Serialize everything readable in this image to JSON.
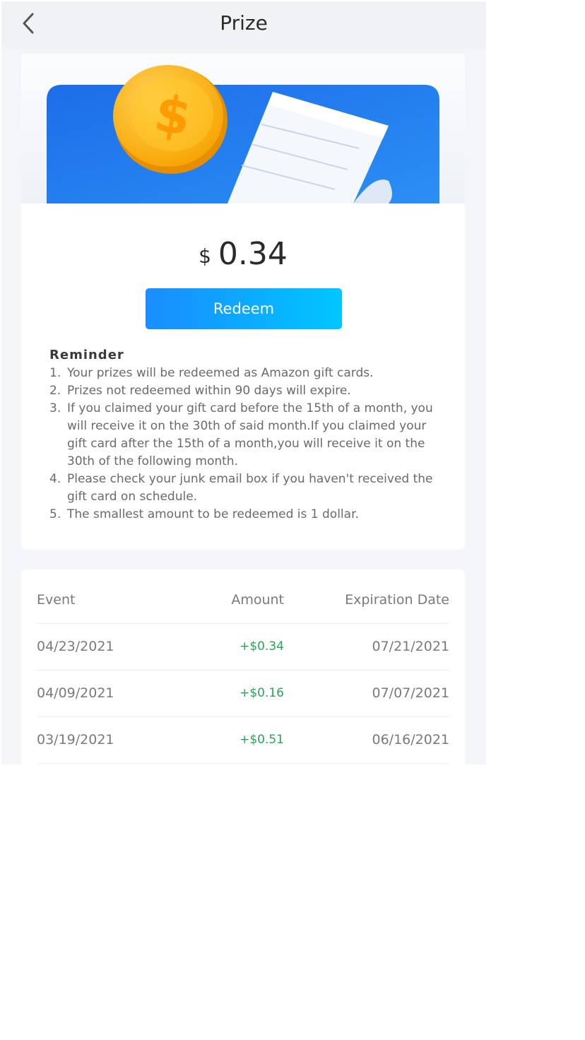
{
  "header": {
    "title": "Prize",
    "back_icon": "chevron-left-icon"
  },
  "banner": {
    "icons": [
      "dollar-coin-icon",
      "receipt-icon"
    ],
    "colors": {
      "blue": "#1f7cf0",
      "coin": "#ffb81a"
    }
  },
  "prize": {
    "currency": "$",
    "amount": "0.34",
    "redeem_label": "Redeem"
  },
  "reminder": {
    "title": "Reminder",
    "items": [
      {
        "num": "1.",
        "text": "Your prizes will be redeemed as Amazon gift cards."
      },
      {
        "num": "2.",
        "text": "Prizes not redeemed within 90 days will expire."
      },
      {
        "num": "3.",
        "text": "If you claimed your gift card before the 15th of a month, you will receive it on the 30th of said month.If you claimed your gift card after the 15th of a month,you will receive it on the 30th of the following month."
      },
      {
        "num": "4.",
        "text": "Please check your junk email box if you haven't received the gift card on schedule."
      },
      {
        "num": "5.",
        "text": "The smallest amount to be redeemed is 1 dollar."
      }
    ]
  },
  "events": {
    "columns": [
      "Event",
      "Amount",
      "Expiration Date"
    ],
    "rows": [
      {
        "event": "04/23/2021",
        "amount": "+$0.34",
        "expiration": "07/21/2021"
      },
      {
        "event": "04/09/2021",
        "amount": "+$0.16",
        "expiration": "07/07/2021"
      },
      {
        "event": "03/19/2021",
        "amount": "+$0.51",
        "expiration": "06/16/2021"
      }
    ],
    "colors": {
      "positive": "#27a55a"
    }
  }
}
